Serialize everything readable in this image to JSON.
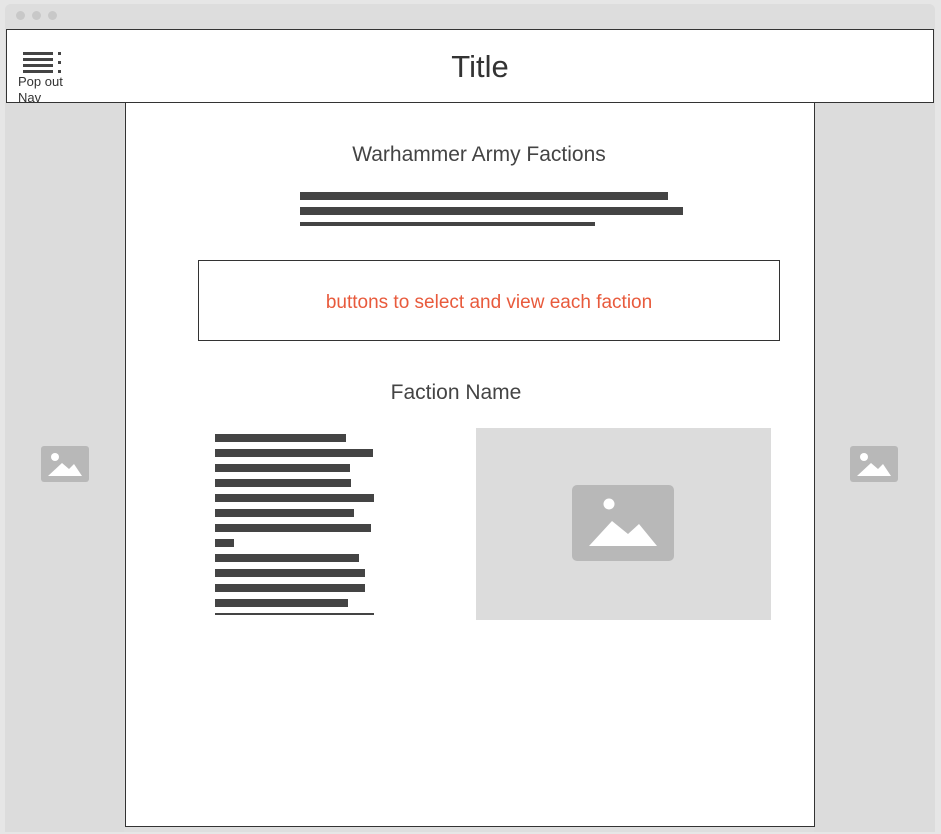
{
  "window": {
    "controls": [
      "close",
      "minimize",
      "maximize"
    ]
  },
  "header": {
    "title": "Title",
    "nav_toggle_label": "Pop out\nNav",
    "nav_icon": "hamburger-menu-icon"
  },
  "content": {
    "heading": "Warhammer Army Factions",
    "faction_selector_label": "buttons to select and view each faction",
    "faction_name": "Faction Name",
    "faction_image_icon": "image-placeholder-icon"
  },
  "side_panels": {
    "left_icon": "image-placeholder-icon",
    "right_icon": "image-placeholder-icon"
  },
  "colors": {
    "accent_text": "#e85a3c",
    "panel_gray": "#dcdcdc",
    "text_dark": "#444444"
  }
}
